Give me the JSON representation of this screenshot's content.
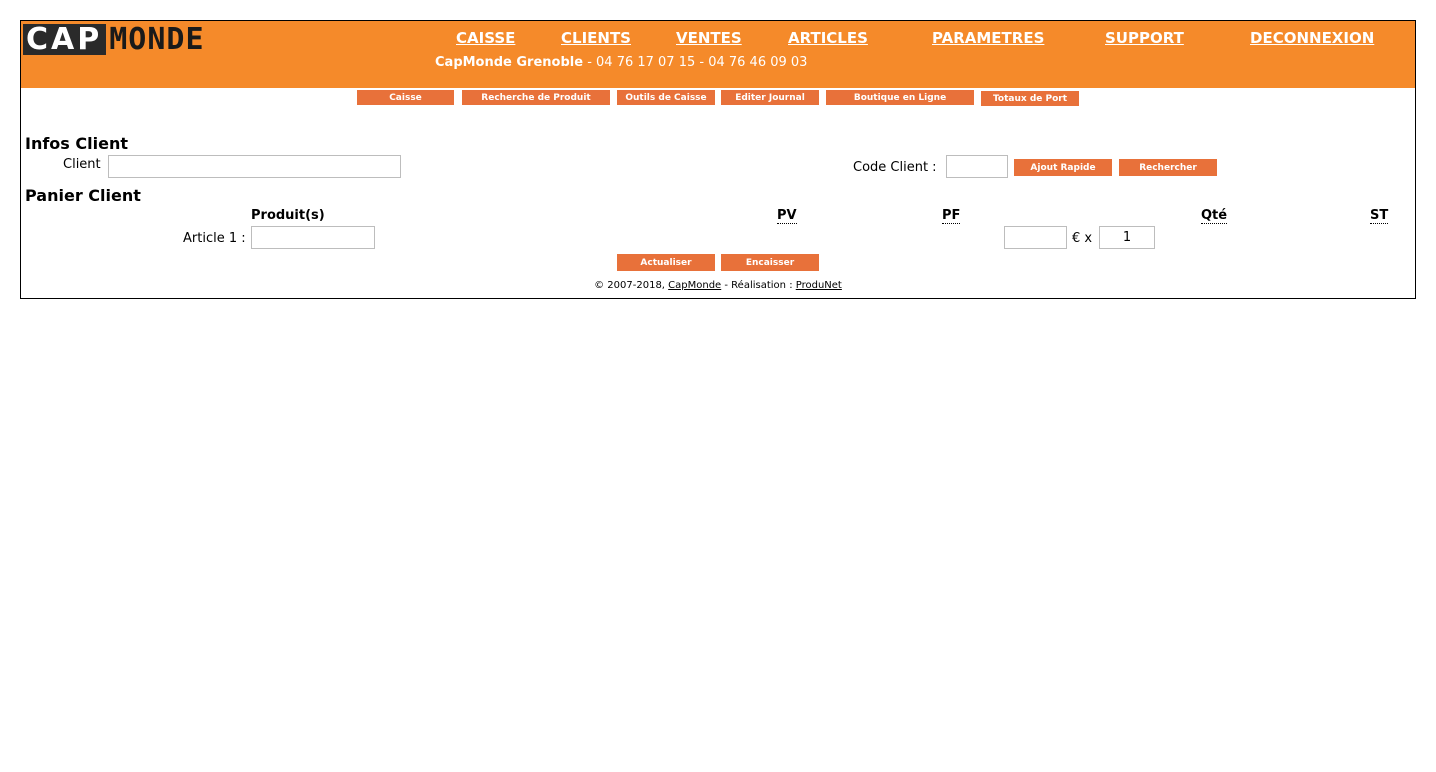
{
  "brand": {
    "logo_left": "CAP",
    "logo_right": "MONDE"
  },
  "nav": [
    {
      "label": "CAISSE"
    },
    {
      "label": "CLIENTS"
    },
    {
      "label": "VENTES"
    },
    {
      "label": "ARTICLES"
    },
    {
      "label": "PARAMETRES"
    },
    {
      "label": "SUPPORT"
    },
    {
      "label": "DECONNEXION"
    }
  ],
  "subtitle": {
    "shop": "CapMonde Grenoble",
    "phones": " - 04 76 17 07 15 - 04 76 46 09 03"
  },
  "subnav": [
    {
      "label": "Caisse"
    },
    {
      "label": "Recherche de Produit"
    },
    {
      "label": "Outils de Caisse"
    },
    {
      "label": "Editer Journal"
    },
    {
      "label": "Boutique en Ligne"
    },
    {
      "label": "Totaux de Port"
    }
  ],
  "infos_client": {
    "heading": "Infos Client",
    "client_label": "Client",
    "client_value": "",
    "code_label": "Code Client :",
    "code_value": "",
    "quick_add_label": "Ajout Rapide",
    "search_label": "Rechercher"
  },
  "panier": {
    "heading": "Panier Client",
    "columns": {
      "product": "Produit(s)",
      "pv": "PV",
      "pf": "PF",
      "qty": "Qté",
      "st": "ST"
    },
    "row": {
      "label": "Article 1 :",
      "product_value": "",
      "price_value": "",
      "currency": "€ x",
      "qty_value": "1"
    },
    "refresh_label": "Actualiser",
    "checkout_label": "Encaisser"
  },
  "footer": {
    "copyright": "© 2007-2018, ",
    "brand_link": "CapMonde",
    "middle": " - Réalisation : ",
    "author_link": "ProduNet"
  },
  "colors": {
    "header": "#f58a2a",
    "button": "#e8713a",
    "text": "#000000"
  }
}
